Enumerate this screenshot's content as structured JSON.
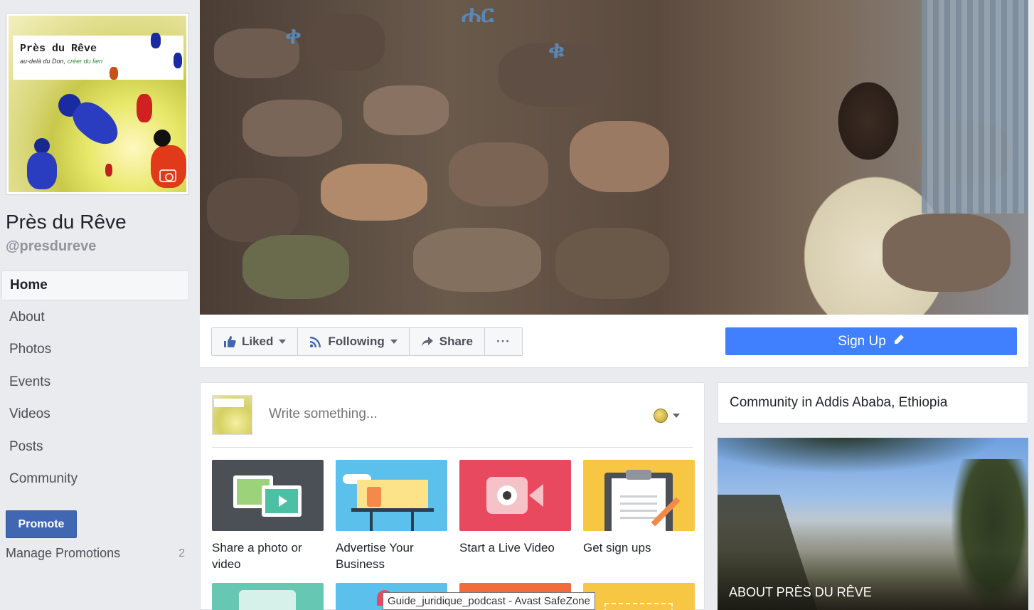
{
  "page": {
    "name": "Près du Rêve",
    "handle": "@presdureve",
    "logo_brand": "Près du Rêve",
    "logo_tagline_start": "au-delà du Don,",
    "logo_tagline_accent": "créer du lien"
  },
  "sidebar": {
    "items": [
      {
        "label": "Home",
        "active": true
      },
      {
        "label": "About"
      },
      {
        "label": "Photos"
      },
      {
        "label": "Events"
      },
      {
        "label": "Videos"
      },
      {
        "label": "Posts"
      },
      {
        "label": "Community"
      }
    ],
    "promote_label": "Promote",
    "manage_promotions_label": "Manage Promotions",
    "manage_promotions_count": "2"
  },
  "cover": {
    "graffiti": [
      "ሐር",
      "ቀ",
      "ቁ"
    ]
  },
  "action_bar": {
    "liked_label": "Liked",
    "following_label": "Following",
    "share_label": "Share",
    "more_label": "···",
    "signup_label": "Sign Up"
  },
  "composer": {
    "placeholder": "Write something...",
    "tiles": [
      {
        "label": "Share a photo or video",
        "color": "#4b4f56"
      },
      {
        "label": "Advertise Your Business",
        "color": "#5bc0eb"
      },
      {
        "label": "Start a Live Video",
        "color": "#e9495f"
      },
      {
        "label": "Get sign ups",
        "color": "#f7c744"
      }
    ],
    "row2_colors": [
      "#66c7b2",
      "#5bc0eb",
      "#f26b3a",
      "#f7c744"
    ]
  },
  "right": {
    "community_text": "Community in Addis Ababa, Ethiopia",
    "about_title": "ABOUT PRÈS DU RÊVE"
  },
  "tooltip": {
    "text": "Guide_juridique_podcast - Avast SafeZone"
  },
  "colors": {
    "facebook_blue": "#4267b2",
    "signup_blue": "#4080ff",
    "background": "#e9ebee"
  }
}
